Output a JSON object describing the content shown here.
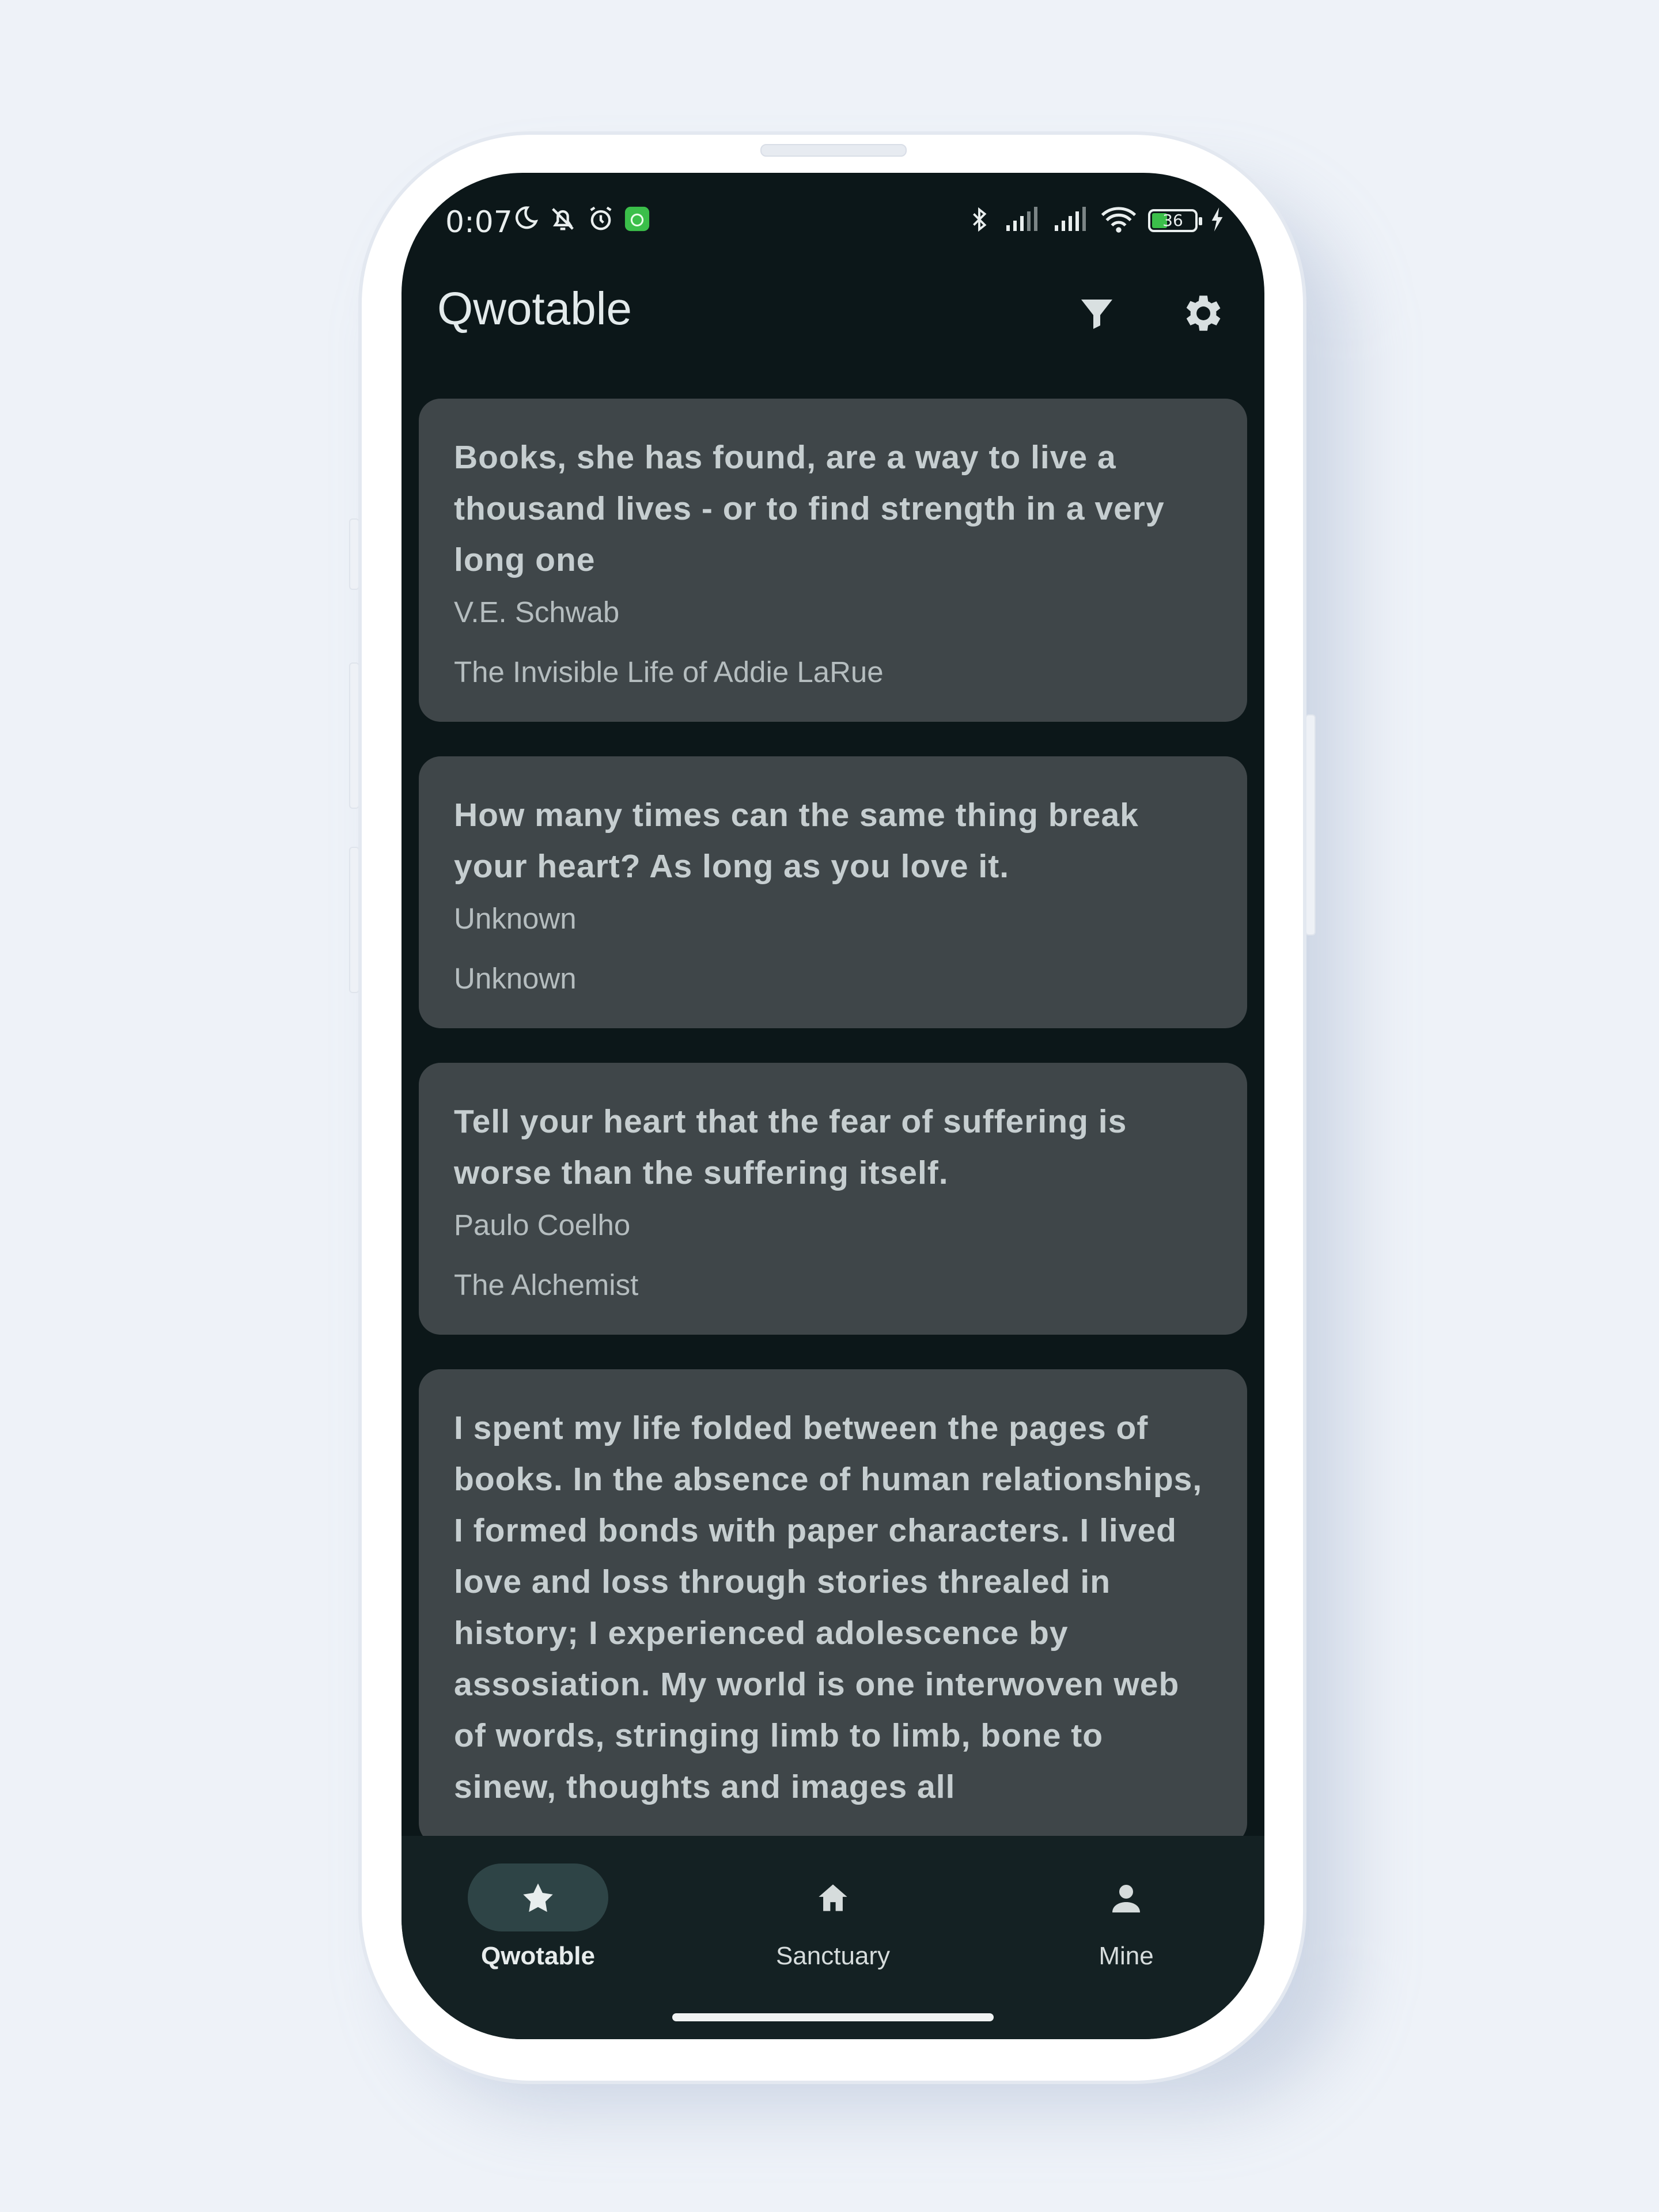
{
  "status_bar": {
    "time": "0:07",
    "battery_level": "36",
    "left_icons": [
      "moon-icon",
      "bell-off-icon",
      "alarm-icon",
      "android-app-icon"
    ],
    "right_icons": [
      "bluetooth-icon",
      "signal-icon",
      "signal-icon",
      "wifi-icon",
      "battery-icon",
      "charging-icon"
    ]
  },
  "app_bar": {
    "title": "Qwotable",
    "actions": [
      "filter-icon",
      "settings-icon"
    ]
  },
  "quotes": [
    {
      "text": "Books, she has found, are a way to live a thousand lives - or to find strength in a very long one",
      "author": "V.E. Schwab",
      "book": "The Invisible Life of Addie LaRue"
    },
    {
      "text": "How many times can the same thing break your heart? As long as you love it.",
      "author": "Unknown",
      "book": "Unknown"
    },
    {
      "text": "Tell your heart that the fear of suffering is worse than the suffering itself.",
      "author": "Paulo Coelho",
      "book": "The Alchemist"
    },
    {
      "text": "I spent my life folded between the pages of books. In the absence of human relationships, I formed bonds with paper characters. I lived love and loss through stories threaled in history; I experienced adolescence by assosiation. My world is one interwoven web of words, stringing limb to limb, bone to sinew, thoughts and images all",
      "author": "",
      "book": ""
    }
  ],
  "bottom_nav": {
    "items": [
      {
        "label": "Qwotable",
        "icon": "star-icon",
        "active": true
      },
      {
        "label": "Sanctuary",
        "icon": "home-icon",
        "active": false
      },
      {
        "label": "Mine",
        "icon": "person-icon",
        "active": false
      }
    ]
  },
  "colors": {
    "screen_bg": "#0c1719",
    "card_bg": "#3f4649",
    "nav_bg": "#142123",
    "active_pill": "#2e4446",
    "text": "#c6ced0"
  }
}
